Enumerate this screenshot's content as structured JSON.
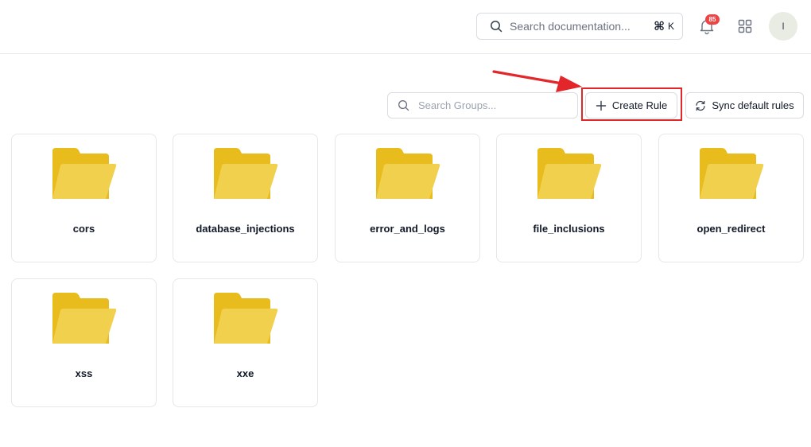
{
  "header": {
    "search_placeholder": "Search documentation...",
    "shortcut_symbol": "⌘",
    "shortcut_key": "K",
    "notification_count": "85",
    "avatar_initial": "I"
  },
  "toolbar": {
    "group_search_placeholder": "Search Groups...",
    "create_rule_label": "Create Rule",
    "sync_label": "Sync default rules"
  },
  "groups": [
    {
      "name": "cors"
    },
    {
      "name": "database_injections"
    },
    {
      "name": "error_and_logs"
    },
    {
      "name": "file_inclusions"
    },
    {
      "name": "open_redirect"
    },
    {
      "name": "xss"
    },
    {
      "name": "xxe"
    }
  ],
  "colors": {
    "folder_back": "#E9BC1E",
    "folder_front": "#F1D04E",
    "annotation_red": "#E3262A",
    "badge_red": "#EF4444"
  }
}
